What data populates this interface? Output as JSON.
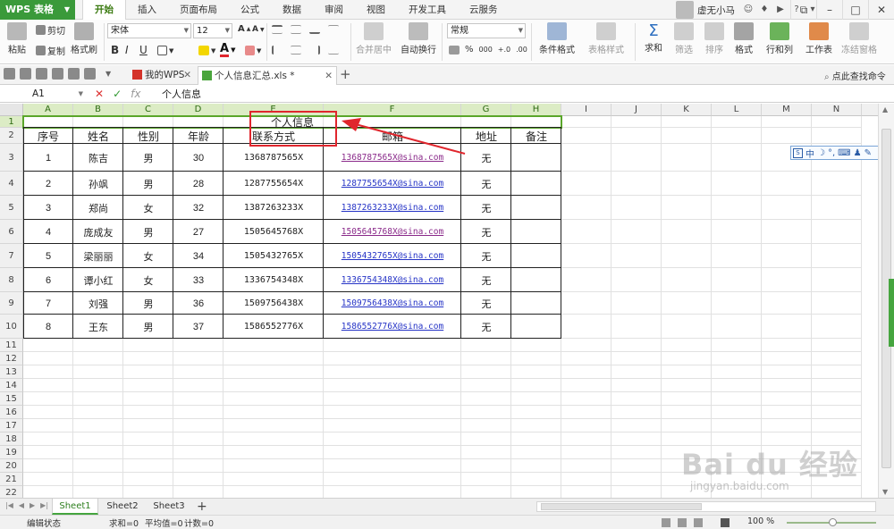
{
  "app": {
    "name": "WPS 表格",
    "menu": [
      "开始",
      "插入",
      "页面布局",
      "公式",
      "数据",
      "审阅",
      "视图",
      "开发工具",
      "云服务"
    ],
    "active_menu": "开始",
    "user": "虚无小马"
  },
  "ribbon": {
    "paste": "粘贴",
    "cut": "剪切",
    "copy": "复制",
    "format_painter": "格式刷",
    "font_name": "宋体",
    "font_size": "12",
    "bold": "B",
    "italic": "I",
    "underline": "U",
    "merge_center": "合并居中",
    "wrap_text": "自动换行",
    "number_format": "常规",
    "percent": "%",
    "cond_format": "条件格式",
    "table_style": "表格样式",
    "sum": "求和",
    "filter": "筛选",
    "sort": "排序",
    "format": "格式",
    "rows_cols": "行和列",
    "worksheet": "工作表",
    "freeze": "冻结窗格"
  },
  "doc_tabs": [
    {
      "label": "我的WPS",
      "active": false
    },
    {
      "label": "个人信息汇总.xls *",
      "active": true
    }
  ],
  "find_command": "点此查找命令",
  "formula_bar": {
    "cell_ref": "A1",
    "fx": "fx",
    "content": "个人信息"
  },
  "columns": [
    "A",
    "B",
    "C",
    "D",
    "E",
    "F",
    "G",
    "H",
    "I",
    "J",
    "K",
    "L",
    "M",
    "N"
  ],
  "sheet": {
    "title": "个人信息",
    "headers": [
      "序号",
      "姓名",
      "性别",
      "年龄",
      "联系方式",
      "邮箱",
      "地址",
      "备注"
    ],
    "rows": [
      [
        "1",
        "陈吉",
        "男",
        "30",
        "1368787565X",
        "1368787565X@sina.com",
        "无",
        ""
      ],
      [
        "2",
        "孙飒",
        "男",
        "28",
        "1287755654X",
        "1287755654X@sina.com",
        "无",
        ""
      ],
      [
        "3",
        "郑尚",
        "女",
        "32",
        "1387263233X",
        "1387263233X@sina.com",
        "无",
        ""
      ],
      [
        "4",
        "庞成友",
        "男",
        "27",
        "1505645768X",
        "1505645768X@sina.com",
        "无",
        ""
      ],
      [
        "5",
        "梁丽丽",
        "女",
        "34",
        "1505432765X",
        "1505432765X@sina.com",
        "无",
        ""
      ],
      [
        "6",
        "谭小红",
        "女",
        "33",
        "1336754348X",
        "1336754348X@sina.com",
        "无",
        ""
      ],
      [
        "7",
        "刘强",
        "男",
        "36",
        "1509756438X",
        "1509756438X@sina.com",
        "无",
        ""
      ],
      [
        "8",
        "王东",
        "男",
        "37",
        "1586552776X",
        "1586552776X@sina.com",
        "无",
        ""
      ]
    ],
    "visited_email_rows": [
      0,
      3
    ],
    "row_numbers": [
      "1",
      "2",
      "3",
      "4",
      "5",
      "6",
      "7",
      "8",
      "9",
      "10",
      "11",
      "12",
      "13",
      "14",
      "15",
      "16",
      "17",
      "18",
      "19",
      "20",
      "21",
      "22"
    ]
  },
  "ime_toolbar": [
    "中",
    "☽",
    "°,",
    "⌨",
    "♟",
    "✎"
  ],
  "sheet_tabs": [
    "Sheet1",
    "Sheet2",
    "Sheet3"
  ],
  "active_sheet": "Sheet1",
  "status": {
    "mode": "编辑状态",
    "sum": "求和=0",
    "avg": "平均值=0",
    "count": "计数=0",
    "zoom": "100 %"
  },
  "watermark": {
    "main": "Bai du 经验",
    "sub": "jingyan.baidu.com"
  },
  "colors": {
    "accent": "#45a53f",
    "selection": "#5aa62a",
    "annotation": "#e0262d",
    "link": "#2533c6",
    "visited_link": "#8a2a8a"
  }
}
